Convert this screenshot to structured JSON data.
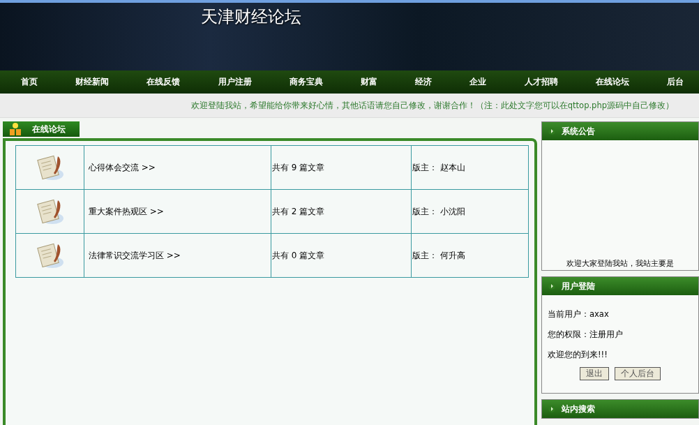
{
  "banner": {
    "title": "天津财经论坛"
  },
  "nav": [
    {
      "label": "首页"
    },
    {
      "label": "财经新闻"
    },
    {
      "label": "在线反馈"
    },
    {
      "label": "用户注册"
    },
    {
      "label": "商务宝典"
    },
    {
      "label": "财富"
    },
    {
      "label": "经济"
    },
    {
      "label": "企业"
    },
    {
      "label": "人才招聘"
    },
    {
      "label": "在线论坛"
    },
    {
      "label": "后台"
    }
  ],
  "welcome": "欢迎登陆我站，希望能给你带来好心情，其他话语请您自己修改，谢谢合作！（注：此处文字您可以在qttop.php源码中自己修改）",
  "forum": {
    "title": "在线论坛",
    "boards": [
      {
        "name": "心得体会交流 >>",
        "count": "共有 9 篇文章",
        "moderator": "版主： 赵本山"
      },
      {
        "name": "重大案件热观区 >>",
        "count": "共有 2 篇文章",
        "moderator": "版主： 小沈阳"
      },
      {
        "name": "法律常识交流学习区 >>",
        "count": "共有 0 篇文章",
        "moderator": "版主： 何升高"
      }
    ]
  },
  "notice": {
    "title": "系统公告",
    "text": "欢迎大家登陆我站，我站主要是"
  },
  "login": {
    "title": "用户登陆",
    "current_user": "当前用户：axax",
    "permission": "您的权限：注册用户",
    "greeting": "欢迎您的到来!!!",
    "buttons": [
      "退出",
      "个人后台"
    ]
  },
  "search": {
    "title": "站内搜索"
  }
}
